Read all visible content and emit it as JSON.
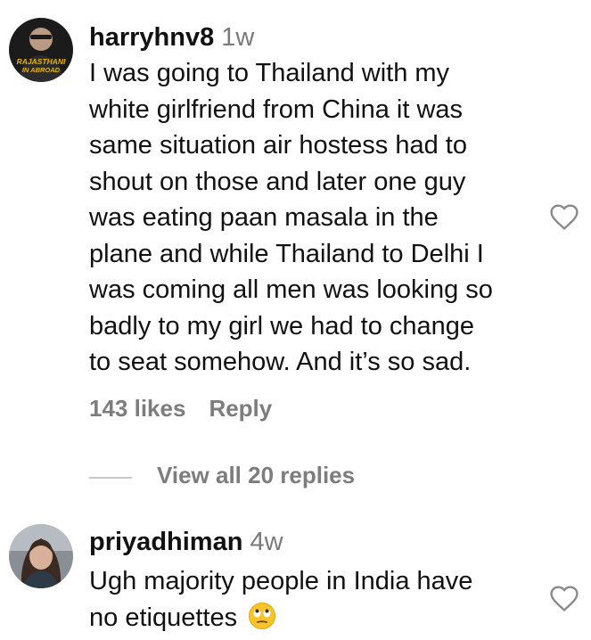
{
  "comments": [
    {
      "username": "harryhnv8",
      "time": "1w",
      "avatar_text": [
        "RAJASTHANI",
        "IN ABROAD"
      ],
      "lines": [
        "I was going to Thailand with my",
        "white girlfriend from China it was",
        "same situation air hostess had to",
        "shout on those and later one guy",
        "was eating paan masala in the",
        "plane and while Thailand to Delhi I",
        "was coming all men was looking so",
        "badly to my girl we had to change",
        "to seat somehow. And it’s so sad."
      ],
      "likes": "143 likes",
      "reply_label": "Reply",
      "view_replies": "View all 20 replies",
      "like_icon": "heart-outline-icon"
    },
    {
      "username": "priyadhiman",
      "time": "4w",
      "lines": [
        "Ugh majority people in India have",
        "no etiquettes"
      ],
      "emoji": "face-with-rolling-eyes-emoji",
      "like_icon": "heart-outline-icon"
    }
  ],
  "colors": {
    "text": "#111111",
    "muted": "#7d7d7d",
    "divider": "#c8c8c8",
    "avatar_badge": "#e8b400"
  }
}
